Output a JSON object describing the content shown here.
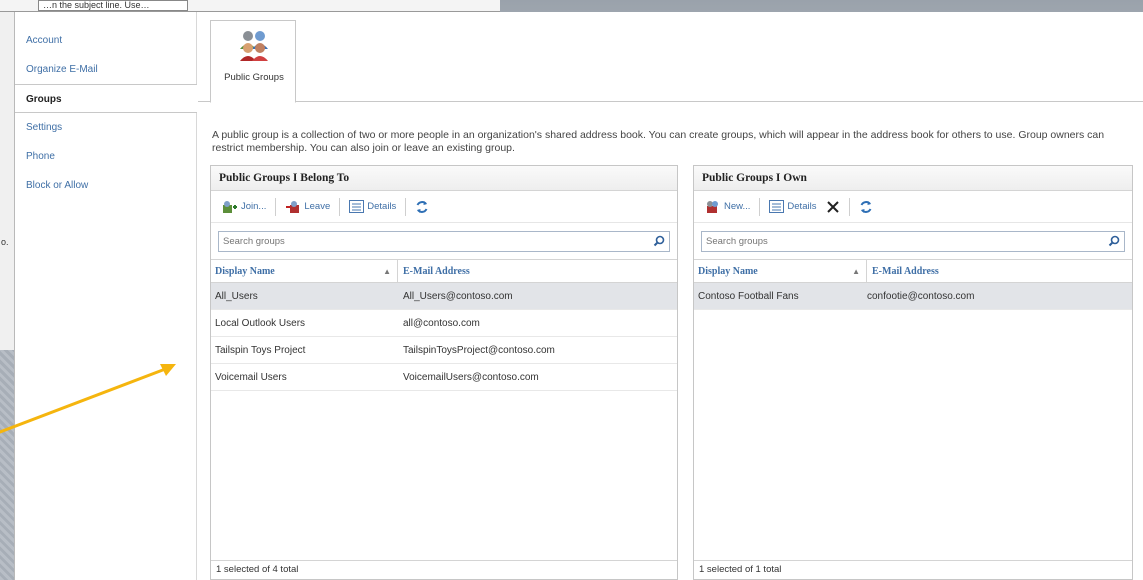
{
  "background": {
    "fragment_text": "…n the subject line. Use…",
    "left_fragment": "o."
  },
  "nav": {
    "items": [
      {
        "label": "Account",
        "active": false
      },
      {
        "label": "Organize E-Mail",
        "active": false
      },
      {
        "label": "Groups",
        "active": true
      },
      {
        "label": "Settings",
        "active": false
      },
      {
        "label": "Phone",
        "active": false
      },
      {
        "label": "Block or Allow",
        "active": false
      }
    ]
  },
  "tab": {
    "label": "Public Groups",
    "icon": "people-group-icon"
  },
  "description": "A public group is a collection of two or more people in an organization's shared address book. You can create groups, which will appear in the address book for others to use. Group owners can restrict membership. You can also join or leave an existing group.",
  "belong_panel": {
    "title": "Public Groups I Belong To",
    "toolbar": {
      "join": "Join...",
      "leave": "Leave",
      "details": "Details"
    },
    "search_placeholder": "Search groups",
    "columns": {
      "name": "Display Name",
      "mail": "E-Mail Address"
    },
    "rows": [
      {
        "name": "All_Users",
        "mail": "All_Users@contoso.com",
        "selected": true
      },
      {
        "name": "Local Outlook Users",
        "mail": "all@contoso.com",
        "selected": false
      },
      {
        "name": "Tailspin Toys Project",
        "mail": "TailspinToysProject@contoso.com",
        "selected": false
      },
      {
        "name": "Voicemail Users",
        "mail": "VoicemailUsers@contoso.com",
        "selected": false
      }
    ],
    "footer": "1 selected of 4 total"
  },
  "own_panel": {
    "title": "Public Groups I Own",
    "toolbar": {
      "new": "New...",
      "details": "Details"
    },
    "search_placeholder": "Search groups",
    "columns": {
      "name": "Display Name",
      "mail": "E-Mail Address"
    },
    "rows": [
      {
        "name": "Contoso Football Fans",
        "mail": "confootie@contoso.com",
        "selected": true
      }
    ],
    "footer": "1 selected of 1 total"
  },
  "colors": {
    "link": "#3f6fa6",
    "selected_row": "#e2e4e8",
    "arrow": "#f5b50e"
  }
}
